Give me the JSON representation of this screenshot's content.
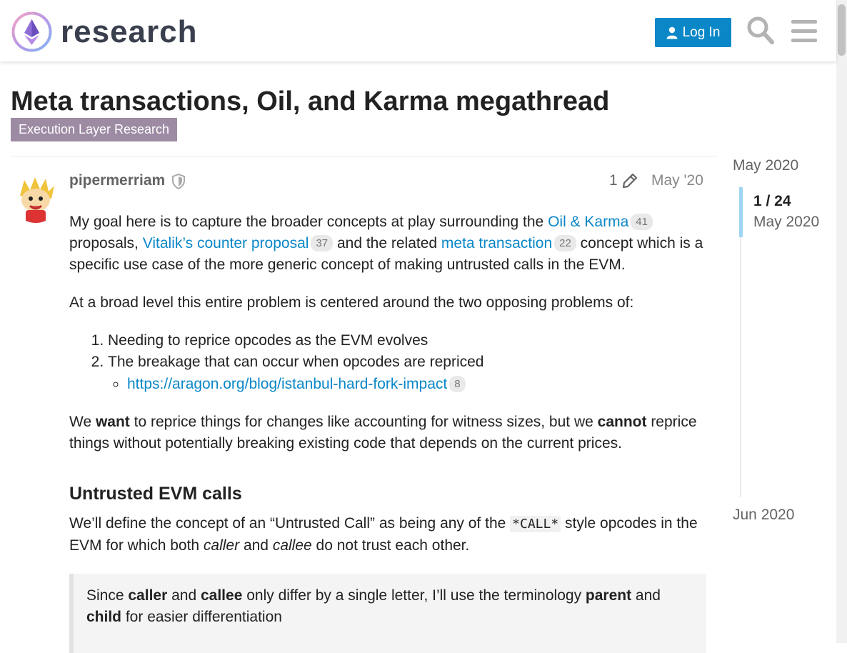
{
  "header": {
    "logo_text": "research",
    "login_label": "Log In"
  },
  "topic": {
    "title": "Meta transactions, Oil, and Karma megathread",
    "category": "Execution Layer Research"
  },
  "post": {
    "username": "pipermerriam",
    "edit_count": "1",
    "date": "May '20",
    "p1": {
      "t1": "My goal here is to capture the broader concepts at play surrounding the ",
      "link1": "Oil & Karma",
      "c1": "41",
      "t2": " proposals, ",
      "link2": "Vitalik’s counter proposal",
      "c2": "37",
      "t3": " and the related ",
      "link3": "meta transaction",
      "c3": "22",
      "t4": " concept which is a specific use case of the more generic concept of making untrusted calls in the EVM."
    },
    "p2": "At a broad level this entire problem is centered around the two opposing problems of:",
    "list": [
      "Needing to reprice opcodes as the EVM evolves",
      "The breakage that can occur when opcodes are repriced"
    ],
    "sublink": "https://aragon.org/blog/istanbul-hard-fork-impact",
    "sublink_count": "8",
    "p3": {
      "t1": "We ",
      "b1": "want",
      "t2": " to reprice things for changes like accounting for witness sizes, but we ",
      "b2": "cannot",
      "t3": " reprice things without potentially breaking existing code that depends on the current prices."
    },
    "heading": "Untrusted EVM calls",
    "p4": {
      "t1": "We’ll define the concept of an “Untrusted Call” as being any of the ",
      "code": "*CALL*",
      "t2": " style opcodes in the EVM for which both ",
      "i1": "caller",
      "t3": " and ",
      "i2": "callee",
      "t4": " do not trust each other."
    },
    "quote": {
      "t1": "Since ",
      "b1": "caller",
      "t2": " and ",
      "b2": "callee",
      "t3": " only differ by a single letter, I’ll use the terminology ",
      "b3": "parent",
      "t4": " and ",
      "b4": "child",
      "t5": " for easier differentiation"
    }
  },
  "timeline": {
    "start_date": "May 2020",
    "position": "1 / 24",
    "current_date": "May 2020",
    "end_date": "Jun 2020"
  },
  "colors": {
    "accent": "#0a87c7",
    "category_bg": "#9d8ba4",
    "timeline_handle": "#9fd5f2"
  }
}
